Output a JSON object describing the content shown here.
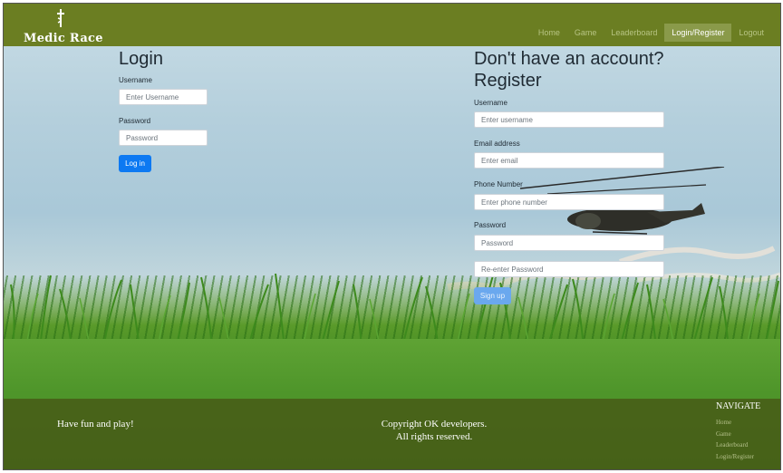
{
  "brand": {
    "name": "Medic Race"
  },
  "navbar": {
    "items": [
      {
        "label": "Home"
      },
      {
        "label": "Game"
      },
      {
        "label": "Leaderboard"
      },
      {
        "label": "Login/Register",
        "active": true
      },
      {
        "label": "Logout"
      }
    ]
  },
  "login": {
    "title": "Login",
    "username_label": "Username",
    "username_placeholder": "Enter Username",
    "password_label": "Password",
    "password_placeholder": "Password",
    "submit_label": "Log in"
  },
  "register": {
    "title_line1": "Don't have an account?",
    "title_line2": "Register",
    "username_label": "Username",
    "username_placeholder": "Enter username",
    "email_label": "Email address",
    "email_placeholder": "Enter email",
    "phone_label": "Phone Number",
    "phone_placeholder": "Enter phone number",
    "password_label": "Password",
    "password_placeholder": "Password",
    "confirm_placeholder": "Re-enter Password",
    "submit_label": "Sign up"
  },
  "footer": {
    "tagline": "Have fun and play!",
    "copyright_line1": "Copyright OK developers.",
    "copyright_line2": "All rights reserved.",
    "nav_heading": "NAVIGATE",
    "links": [
      {
        "label": "Home"
      },
      {
        "label": "Game"
      },
      {
        "label": "Leaderboard"
      },
      {
        "label": "Login/Register"
      }
    ]
  },
  "colors": {
    "navbar": "#6b7e22",
    "primary_button": "#0d79f2",
    "footer_overlay": "#465014"
  },
  "icons": {
    "logo": "cross-stick-icon",
    "background": "helicopter-over-grass"
  }
}
